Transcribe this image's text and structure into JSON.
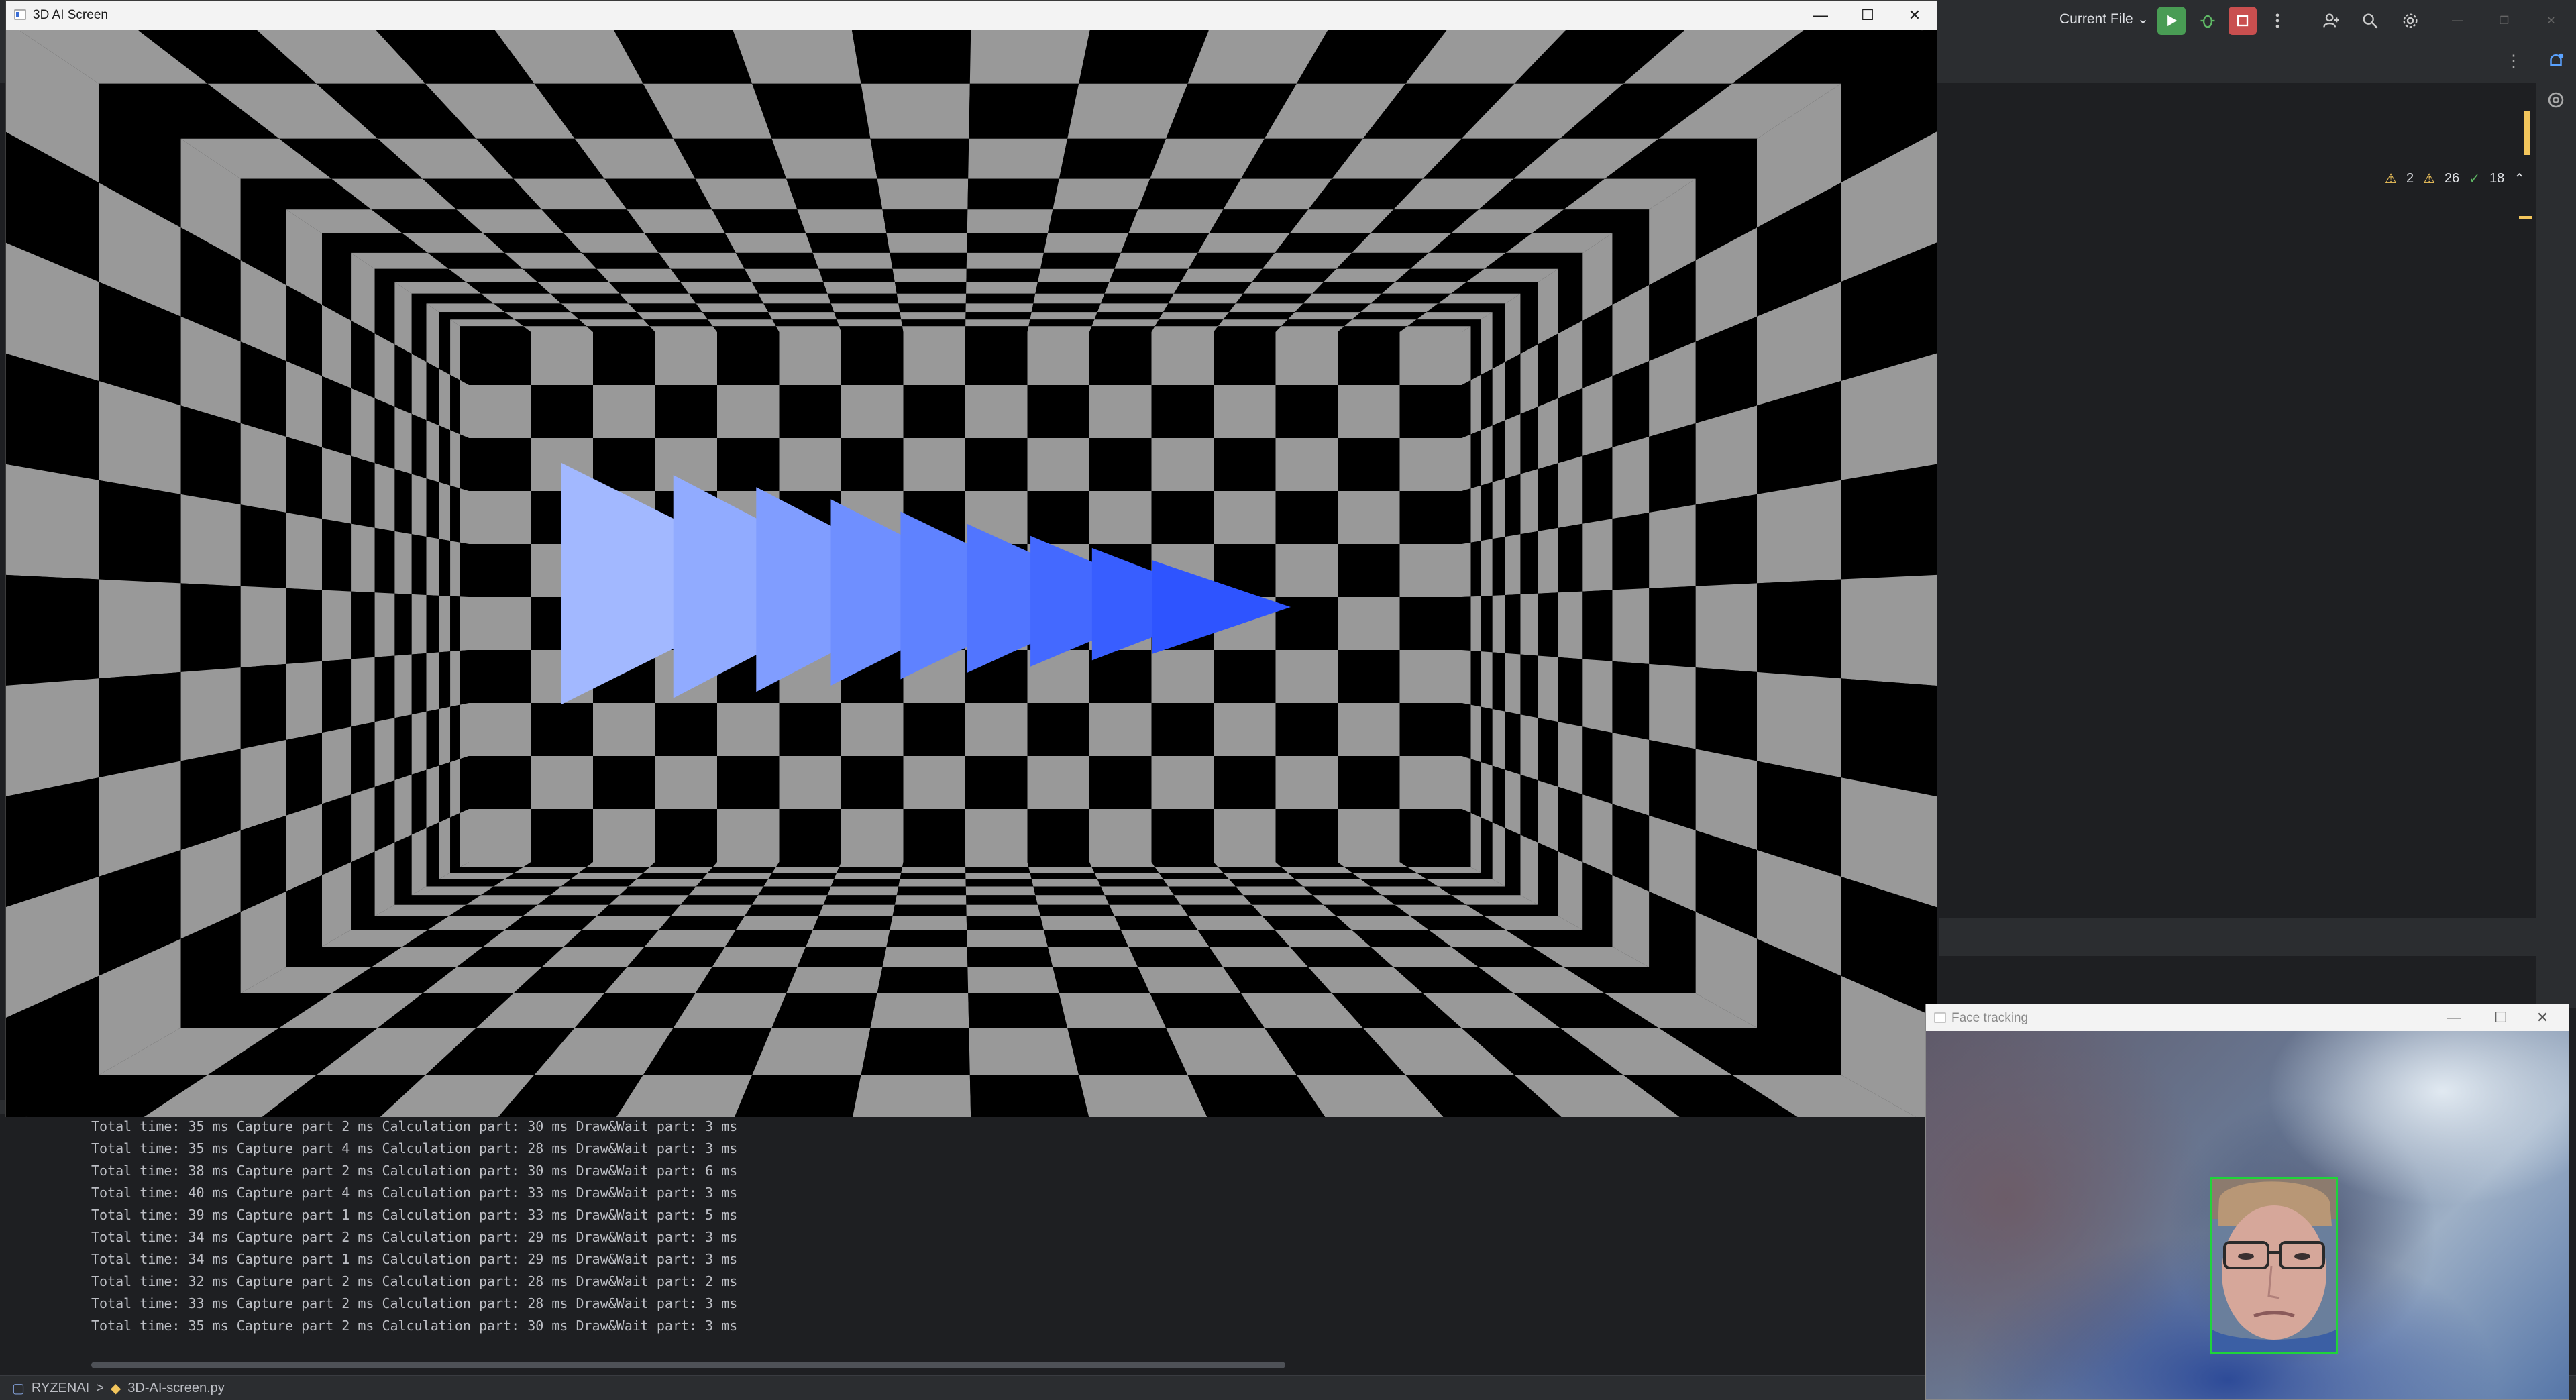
{
  "ide": {
    "run_config_label": "Current File",
    "inspections": {
      "warnings_a": "2",
      "warnings_b": "26",
      "ok_count": "18"
    },
    "console_lines": [
      "Total time: 35 ms Capture part 2 ms Calculation part: 30 ms Draw&Wait part: 3 ms",
      "Total time: 35 ms Capture part 4 ms Calculation part: 28 ms Draw&Wait part: 3 ms",
      "Total time: 38 ms Capture part 2 ms Calculation part: 30 ms Draw&Wait part: 6 ms",
      "Total time: 40 ms Capture part 4 ms Calculation part: 33 ms Draw&Wait part: 3 ms",
      "Total time: 39 ms Capture part 1 ms Calculation part: 33 ms Draw&Wait part: 5 ms",
      "Total time: 34 ms Capture part 2 ms Calculation part: 29 ms Draw&Wait part: 3 ms",
      "Total time: 34 ms Capture part 1 ms Calculation part: 29 ms Draw&Wait part: 3 ms",
      "Total time: 32 ms Capture part 2 ms Calculation part: 28 ms Draw&Wait part: 2 ms",
      "Total time: 33 ms Capture part 2 ms Calculation part: 28 ms Draw&Wait part: 3 ms",
      "Total time: 35 ms Capture part 2 ms Calculation part: 30 ms Draw&Wait part: 3 ms"
    ],
    "statusbar": {
      "project": "RYZENAI",
      "separator": ">",
      "file": "3D-AI-screen.py"
    }
  },
  "ai_window": {
    "title": "3D AI Screen",
    "checker_colors": {
      "dark": "#000000",
      "light": "#999999"
    },
    "arrow_colors": [
      "#a2b8ff",
      "#91abff",
      "#809dff",
      "#6f8fff",
      "#5f82ff",
      "#5175ff",
      "#4469ff",
      "#385eff",
      "#2e54ff"
    ]
  },
  "face_window": {
    "title": "Face tracking",
    "face_box_color": "#1fd43a"
  },
  "icons": {
    "minimize": "minimize-icon",
    "maximize": "maximize-icon",
    "close": "close-icon",
    "run": "run-icon",
    "debug": "debug-icon",
    "stop": "stop-icon",
    "more": "more-icon",
    "add_user": "add-user-icon",
    "search": "search-icon",
    "settings": "gear-icon",
    "notifications": "bell-icon",
    "ai_assistant": "ai-assistant-icon"
  }
}
